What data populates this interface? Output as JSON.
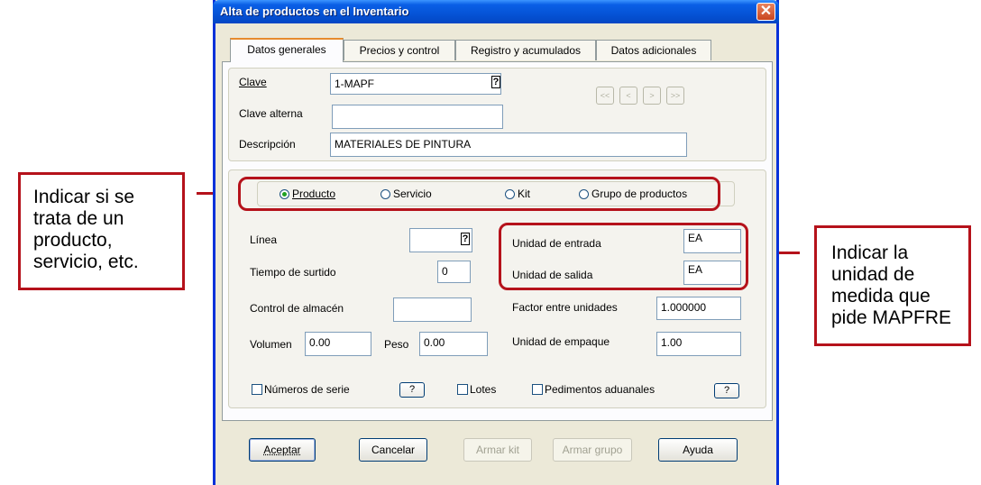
{
  "window": {
    "title": "Alta de productos en el Inventario",
    "close_glyph": "✕"
  },
  "tabs": [
    "Datos generales",
    "Precios y control",
    "Registro y acumulados",
    "Datos adicionales"
  ],
  "identity": {
    "clave_label": "Clave",
    "clave_value": "1-MAPF",
    "clave_alterna_label": "Clave alterna",
    "clave_alterna_value": "",
    "descripcion_label": "Descripción",
    "descripcion_value": "MATERIALES DE PINTURA",
    "lookup_glyph": "?"
  },
  "nav_buttons": [
    "<<",
    "<",
    ">",
    ">>"
  ],
  "product_type": {
    "options": [
      "Producto",
      "Servicio",
      "Kit",
      "Grupo de productos"
    ],
    "selected": "Producto"
  },
  "fields": {
    "linea_label": "Línea",
    "linea_value": "",
    "tiempo_label": "Tiempo de surtido",
    "tiempo_value": "0",
    "control_label": "Control de almacén",
    "control_value": "",
    "volumen_label": "Volumen",
    "volumen_value": "0.00",
    "peso_label": "Peso",
    "peso_value": "0.00",
    "unidad_entrada_label": "Unidad de entrada",
    "unidad_entrada_value": "EA",
    "unidad_salida_label": "Unidad de salida",
    "unidad_salida_value": "EA",
    "factor_label": "Factor entre unidades",
    "factor_value": "1.000000",
    "empaque_label": "Unidad de empaque",
    "empaque_value": "1.00"
  },
  "checks": {
    "series_label": "Números de serie",
    "lotes_label": "Lotes",
    "pedimentos_label": "Pedimentos aduanales",
    "help_glyph": "?"
  },
  "buttons": {
    "aceptar": "Aceptar",
    "cancelar": "Cancelar",
    "armar_kit": "Armar kit",
    "armar_grupo": "Armar grupo",
    "ayuda": "Ayuda"
  },
  "annotations": {
    "left": [
      "Indicar si se",
      "trata de un",
      "producto,",
      "servicio, etc."
    ],
    "right": [
      "Indicar la",
      "unidad de",
      "medida que",
      "pide MAPFRE"
    ]
  },
  "colors": {
    "annotation": "#b5121b",
    "titlebar": "#0553d6",
    "dialog_bg": "#ece9d8"
  }
}
